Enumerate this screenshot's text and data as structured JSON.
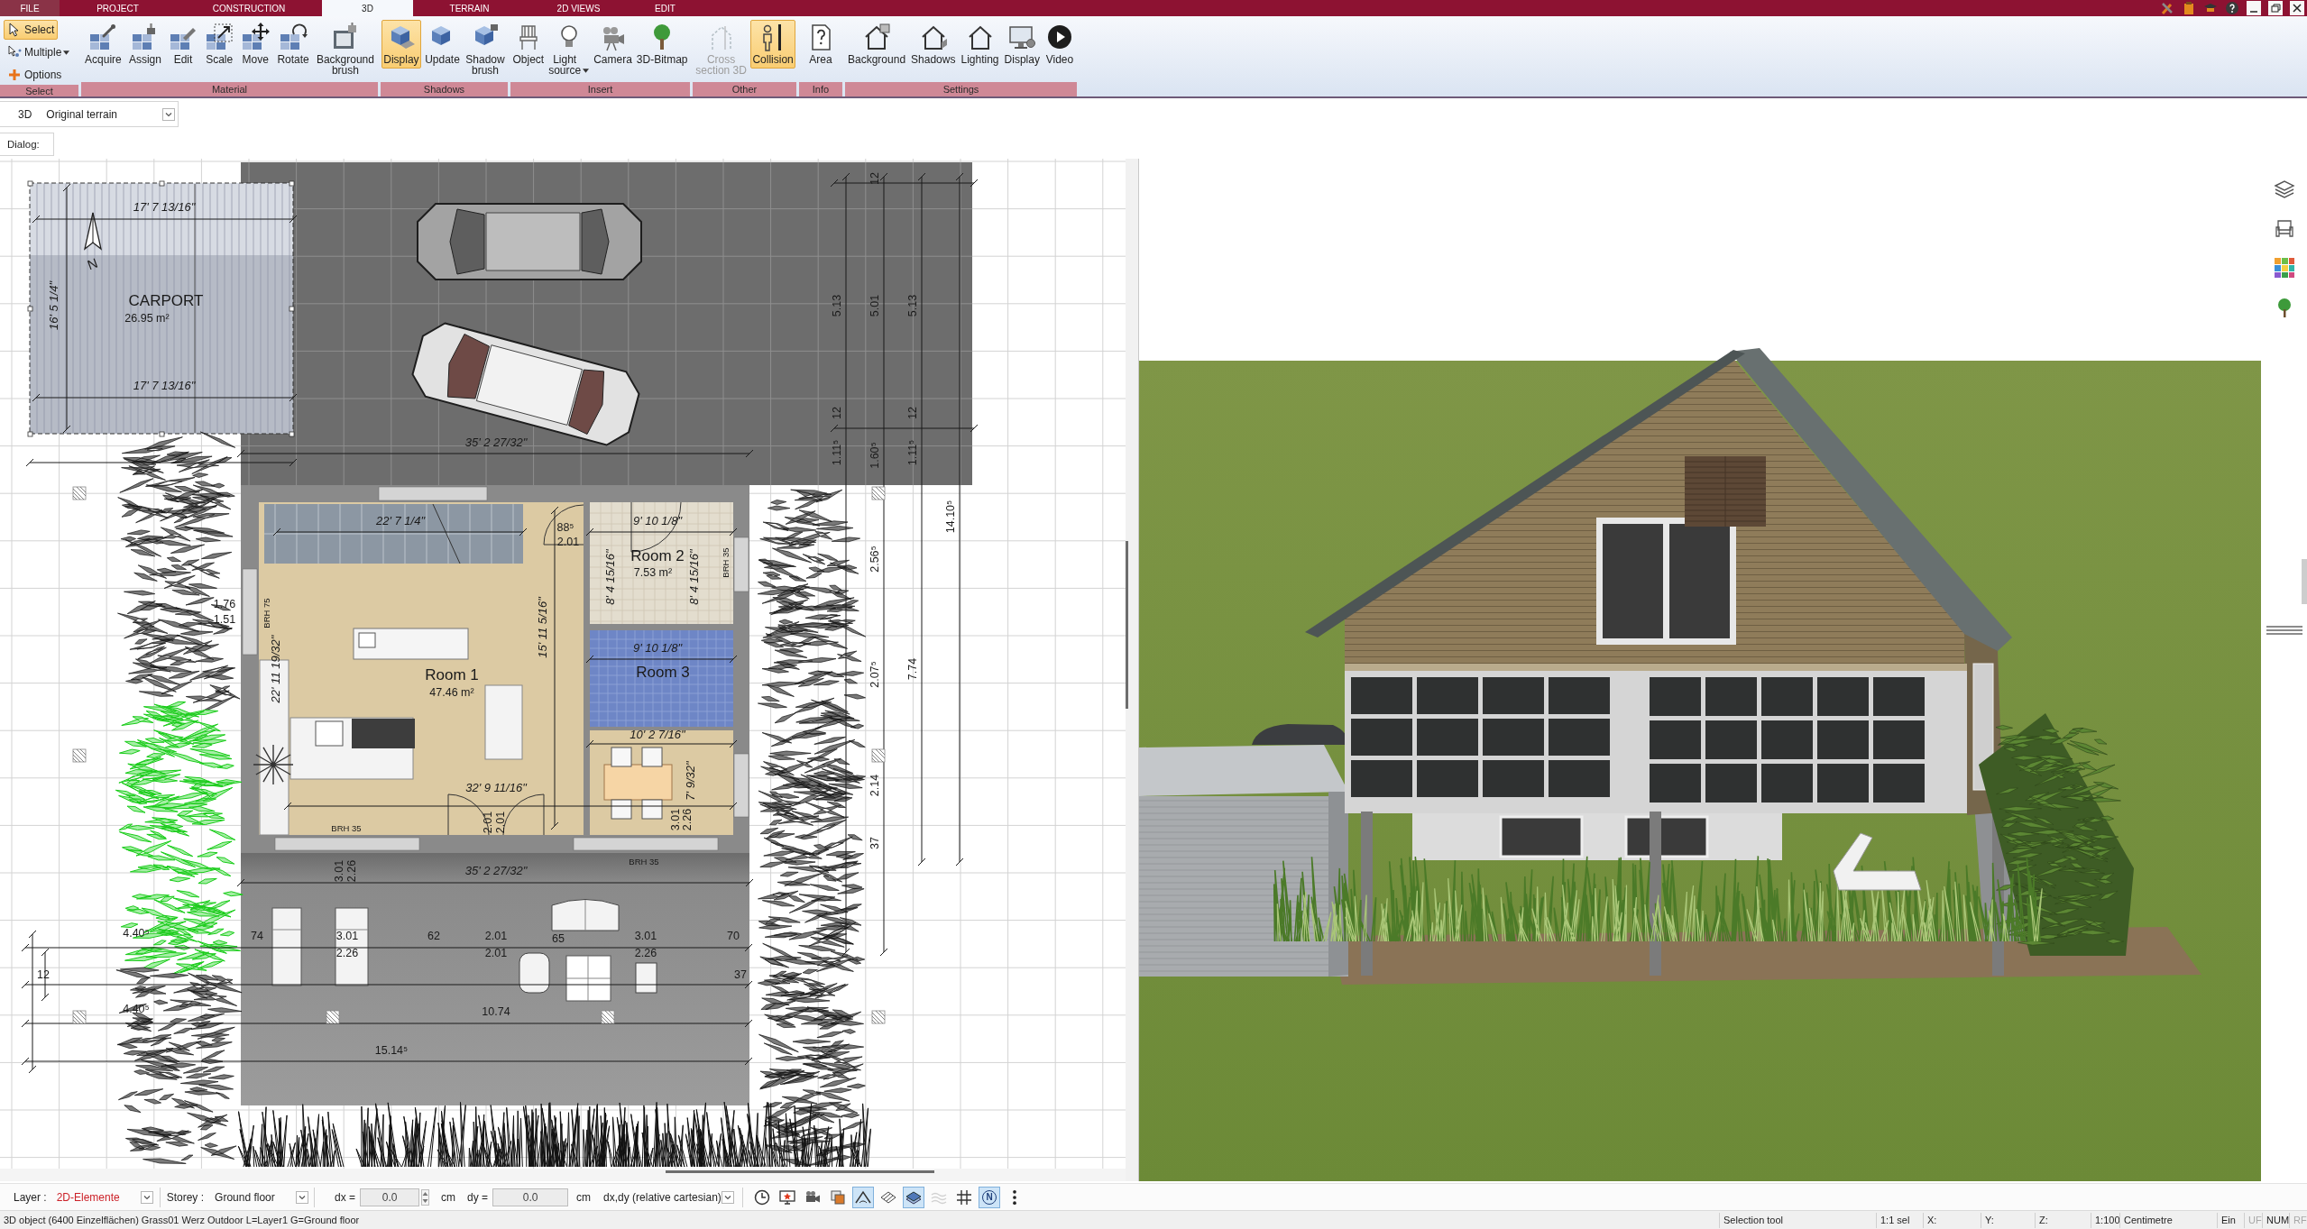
{
  "title_bar": {
    "tabs": [
      {
        "label": "FILE",
        "kind": "menu",
        "selected": false
      },
      {
        "label": "PROJECT",
        "kind": "tab",
        "selected": false
      },
      {
        "label": "CONSTRUCTION",
        "kind": "tab",
        "selected": false
      },
      {
        "label": "3D",
        "kind": "tab",
        "selected": true
      },
      {
        "label": "TERRAIN",
        "kind": "tab",
        "selected": false
      },
      {
        "label": "2D VIEWS",
        "kind": "tab",
        "selected": false
      },
      {
        "label": "EDIT",
        "kind": "tab",
        "selected": false
      }
    ]
  },
  "ribbon": {
    "groups": [
      {
        "label": "Select",
        "buttons": [
          {
            "label": "Select",
            "kind": "small",
            "active": true,
            "disabled": false,
            "dropdown": false
          },
          {
            "label": "Multiple",
            "kind": "small",
            "active": false,
            "disabled": false,
            "dropdown": true
          },
          {
            "label": "Options",
            "kind": "small",
            "active": false,
            "disabled": false,
            "dropdown": false
          }
        ]
      },
      {
        "label": "Material",
        "buttons": [
          {
            "label": "Acquire",
            "kind": "large",
            "active": false,
            "disabled": false,
            "dropdown": false
          },
          {
            "label": "Assign",
            "kind": "large",
            "active": false,
            "disabled": false,
            "dropdown": false
          },
          {
            "label": "Edit",
            "kind": "large",
            "active": false,
            "disabled": false,
            "dropdown": false
          },
          {
            "label": "Scale",
            "kind": "large",
            "active": false,
            "disabled": false,
            "dropdown": false
          },
          {
            "label": "Move",
            "kind": "large",
            "active": false,
            "disabled": false,
            "dropdown": false
          },
          {
            "label": "Rotate",
            "kind": "large",
            "active": false,
            "disabled": false,
            "dropdown": false
          },
          {
            "label": "Background\nbrush",
            "kind": "large",
            "active": false,
            "disabled": false,
            "dropdown": false
          }
        ]
      },
      {
        "label": "Shadows",
        "buttons": [
          {
            "label": "Display",
            "kind": "large",
            "active": true,
            "disabled": false,
            "dropdown": false
          },
          {
            "label": "Update",
            "kind": "large",
            "active": false,
            "disabled": false,
            "dropdown": false
          },
          {
            "label": "Shadow\nbrush",
            "kind": "large",
            "active": false,
            "disabled": false,
            "dropdown": false
          }
        ]
      },
      {
        "label": "Insert",
        "buttons": [
          {
            "label": "Object",
            "kind": "large",
            "active": false,
            "disabled": false,
            "dropdown": false
          },
          {
            "label": "Light\nsource",
            "kind": "large",
            "active": false,
            "disabled": false,
            "dropdown": true
          },
          {
            "label": "Camera",
            "kind": "large",
            "active": false,
            "disabled": false,
            "dropdown": false
          },
          {
            "label": "3D-Bitmap",
            "kind": "large",
            "active": false,
            "disabled": false,
            "dropdown": false
          }
        ]
      },
      {
        "label": "Other",
        "buttons": [
          {
            "label": "Cross\nsection 3D",
            "kind": "large",
            "active": false,
            "disabled": true,
            "dropdown": false
          },
          {
            "label": "Collision",
            "kind": "large",
            "active": true,
            "disabled": false,
            "dropdown": false
          }
        ]
      },
      {
        "label": "Info",
        "buttons": [
          {
            "label": "Area",
            "kind": "large",
            "active": false,
            "disabled": false,
            "dropdown": false
          }
        ]
      },
      {
        "label": "Settings",
        "buttons": [
          {
            "label": "Background",
            "kind": "large",
            "active": false,
            "disabled": false,
            "dropdown": false
          },
          {
            "label": "Shadows",
            "kind": "large",
            "active": false,
            "disabled": false,
            "dropdown": false
          },
          {
            "label": "Lighting",
            "kind": "large",
            "active": false,
            "disabled": false,
            "dropdown": false
          },
          {
            "label": "Display",
            "kind": "large",
            "active": false,
            "disabled": false,
            "dropdown": false
          },
          {
            "label": "Video",
            "kind": "large",
            "active": false,
            "disabled": false,
            "dropdown": false
          }
        ]
      }
    ]
  },
  "view_bar": {
    "mode": "3D",
    "terrain": "Original terrain"
  },
  "dialog": {
    "label": "Dialog:"
  },
  "plan": {
    "labels": [
      {
        "text": "17' 7 13/16\"",
        "kind": "imperial"
      },
      {
        "text": "N",
        "kind": "north"
      },
      {
        "text": "16' 5 1/4\"",
        "kind": "imperial"
      },
      {
        "text": "CARPORT",
        "kind": "room"
      },
      {
        "text": "26.95 m²",
        "kind": "area"
      },
      {
        "text": "17' 7 13/16\"",
        "kind": "imperial"
      },
      {
        "text": "12",
        "kind": "metric"
      },
      {
        "text": "5.13",
        "kind": "metric"
      },
      {
        "text": "5.01",
        "kind": "metric"
      },
      {
        "text": "5.13",
        "kind": "metric"
      },
      {
        "text": "12",
        "kind": "metric"
      },
      {
        "text": "12",
        "kind": "metric"
      },
      {
        "text": "35' 2 27/32\"",
        "kind": "imperial"
      },
      {
        "text": "1.11⁵",
        "kind": "metric"
      },
      {
        "text": "1.60⁵",
        "kind": "metric"
      },
      {
        "text": "1.11⁵",
        "kind": "metric"
      },
      {
        "text": "14.10⁵",
        "kind": "metric"
      },
      {
        "text": "22' 7 1/4\"",
        "kind": "imperial"
      },
      {
        "text": "88⁵",
        "kind": "metric"
      },
      {
        "text": "2.01",
        "kind": "metric"
      },
      {
        "text": "9' 10 1/8\"",
        "kind": "imperial"
      },
      {
        "text": "Room 2",
        "kind": "room"
      },
      {
        "text": "7.53 m²",
        "kind": "area"
      },
      {
        "text": "8' 4 15/16\"",
        "kind": "imperial"
      },
      {
        "text": "8' 4 15/16\"",
        "kind": "imperial"
      },
      {
        "text": "BRH 35",
        "kind": "note"
      },
      {
        "text": "2.56⁵",
        "kind": "metric"
      },
      {
        "text": "BRH 75",
        "kind": "note"
      },
      {
        "text": "1.76",
        "kind": "metric"
      },
      {
        "text": "1.51",
        "kind": "metric"
      },
      {
        "text": "15' 11 5/16\"",
        "kind": "imperial"
      },
      {
        "text": "9' 10 1/8\"",
        "kind": "imperial"
      },
      {
        "text": "22' 11 19/32\"",
        "kind": "imperial"
      },
      {
        "text": "Room 1",
        "kind": "room"
      },
      {
        "text": "47.46 m²",
        "kind": "area"
      },
      {
        "text": "Room 3",
        "kind": "room"
      },
      {
        "text": "7.74",
        "kind": "metric"
      },
      {
        "text": "2.07⁵",
        "kind": "metric"
      },
      {
        "text": "10' 2 7/16\"",
        "kind": "imperial"
      },
      {
        "text": "2.14",
        "kind": "metric"
      },
      {
        "text": "7' 9/32\"",
        "kind": "imperial"
      },
      {
        "text": "32' 9 11/16\"",
        "kind": "imperial"
      },
      {
        "text": "3.01",
        "kind": "metric"
      },
      {
        "text": "2.26",
        "kind": "metric"
      },
      {
        "text": "2.01",
        "kind": "metric"
      },
      {
        "text": "2.01",
        "kind": "metric"
      },
      {
        "text": "BRH 35",
        "kind": "note"
      },
      {
        "text": "37",
        "kind": "metric"
      },
      {
        "text": "BRH 35",
        "kind": "note"
      },
      {
        "text": "3.01",
        "kind": "metric"
      },
      {
        "text": "2.26",
        "kind": "metric"
      },
      {
        "text": "35' 2 27/32\"",
        "kind": "imperial"
      },
      {
        "text": "4.40⁵",
        "kind": "metric"
      },
      {
        "text": "74",
        "kind": "metric"
      },
      {
        "text": "3.01",
        "kind": "metric"
      },
      {
        "text": "2.26",
        "kind": "metric"
      },
      {
        "text": "62",
        "kind": "metric"
      },
      {
        "text": "2.01",
        "kind": "metric"
      },
      {
        "text": "2.01",
        "kind": "metric"
      },
      {
        "text": "65",
        "kind": "metric"
      },
      {
        "text": "3.01",
        "kind": "metric"
      },
      {
        "text": "2.26",
        "kind": "metric"
      },
      {
        "text": "70",
        "kind": "metric"
      },
      {
        "text": "12",
        "kind": "metric"
      },
      {
        "text": "37",
        "kind": "metric"
      },
      {
        "text": "4.40⁵",
        "kind": "metric"
      },
      {
        "text": "10.74",
        "kind": "metric"
      },
      {
        "text": "15.14⁵",
        "kind": "metric"
      }
    ]
  },
  "toolbar": {
    "layer": {
      "label": "Layer :",
      "value": "2D-Elemente"
    },
    "storey": {
      "label": "Storey :",
      "value": "Ground floor"
    },
    "dx": {
      "label": "dx =",
      "value": "0.0",
      "unit": "cm",
      "disabled": true
    },
    "dy": {
      "label": "dy =",
      "value": "0.0",
      "unit": "cm",
      "disabled": true
    },
    "coordinate_mode": "dx,dy (relative cartesian)",
    "tools": [
      {
        "kind": "icon",
        "active": false,
        "disabled": false
      },
      {
        "kind": "icon",
        "active": false,
        "disabled": false
      },
      {
        "kind": "icon",
        "active": false,
        "disabled": false
      },
      {
        "kind": "icon",
        "active": false,
        "disabled": false
      },
      {
        "kind": "icon",
        "active": true,
        "disabled": false
      },
      {
        "kind": "icon",
        "active": false,
        "disabled": false
      },
      {
        "kind": "icon",
        "active": true,
        "disabled": false
      },
      {
        "kind": "icon",
        "active": false,
        "disabled": true
      },
      {
        "kind": "icon",
        "active": false,
        "disabled": false
      },
      {
        "kind": "letter",
        "text": "N",
        "active": true,
        "disabled": false
      },
      {
        "kind": "icon",
        "active": false,
        "disabled": false
      }
    ]
  },
  "status_bar": {
    "message": "3D object (6400 Einzelflächen) Grass01 Werz Outdoor L=Layer1 G=Ground floor",
    "fields": [
      {
        "text": "Selection tool",
        "disabled": false
      },
      {
        "text": "1:1 sel",
        "disabled": false
      },
      {
        "text": "X:",
        "disabled": false
      },
      {
        "text": "Y:",
        "disabled": false
      },
      {
        "text": "Z:",
        "disabled": false
      },
      {
        "text": "1:100",
        "disabled": false
      },
      {
        "text": "Centimetre",
        "disabled": false
      },
      {
        "text": "Ein",
        "disabled": false
      },
      {
        "text": "UF",
        "disabled": true
      },
      {
        "text": "NUM",
        "disabled": false
      },
      {
        "text": "RF",
        "disabled": true
      }
    ]
  }
}
